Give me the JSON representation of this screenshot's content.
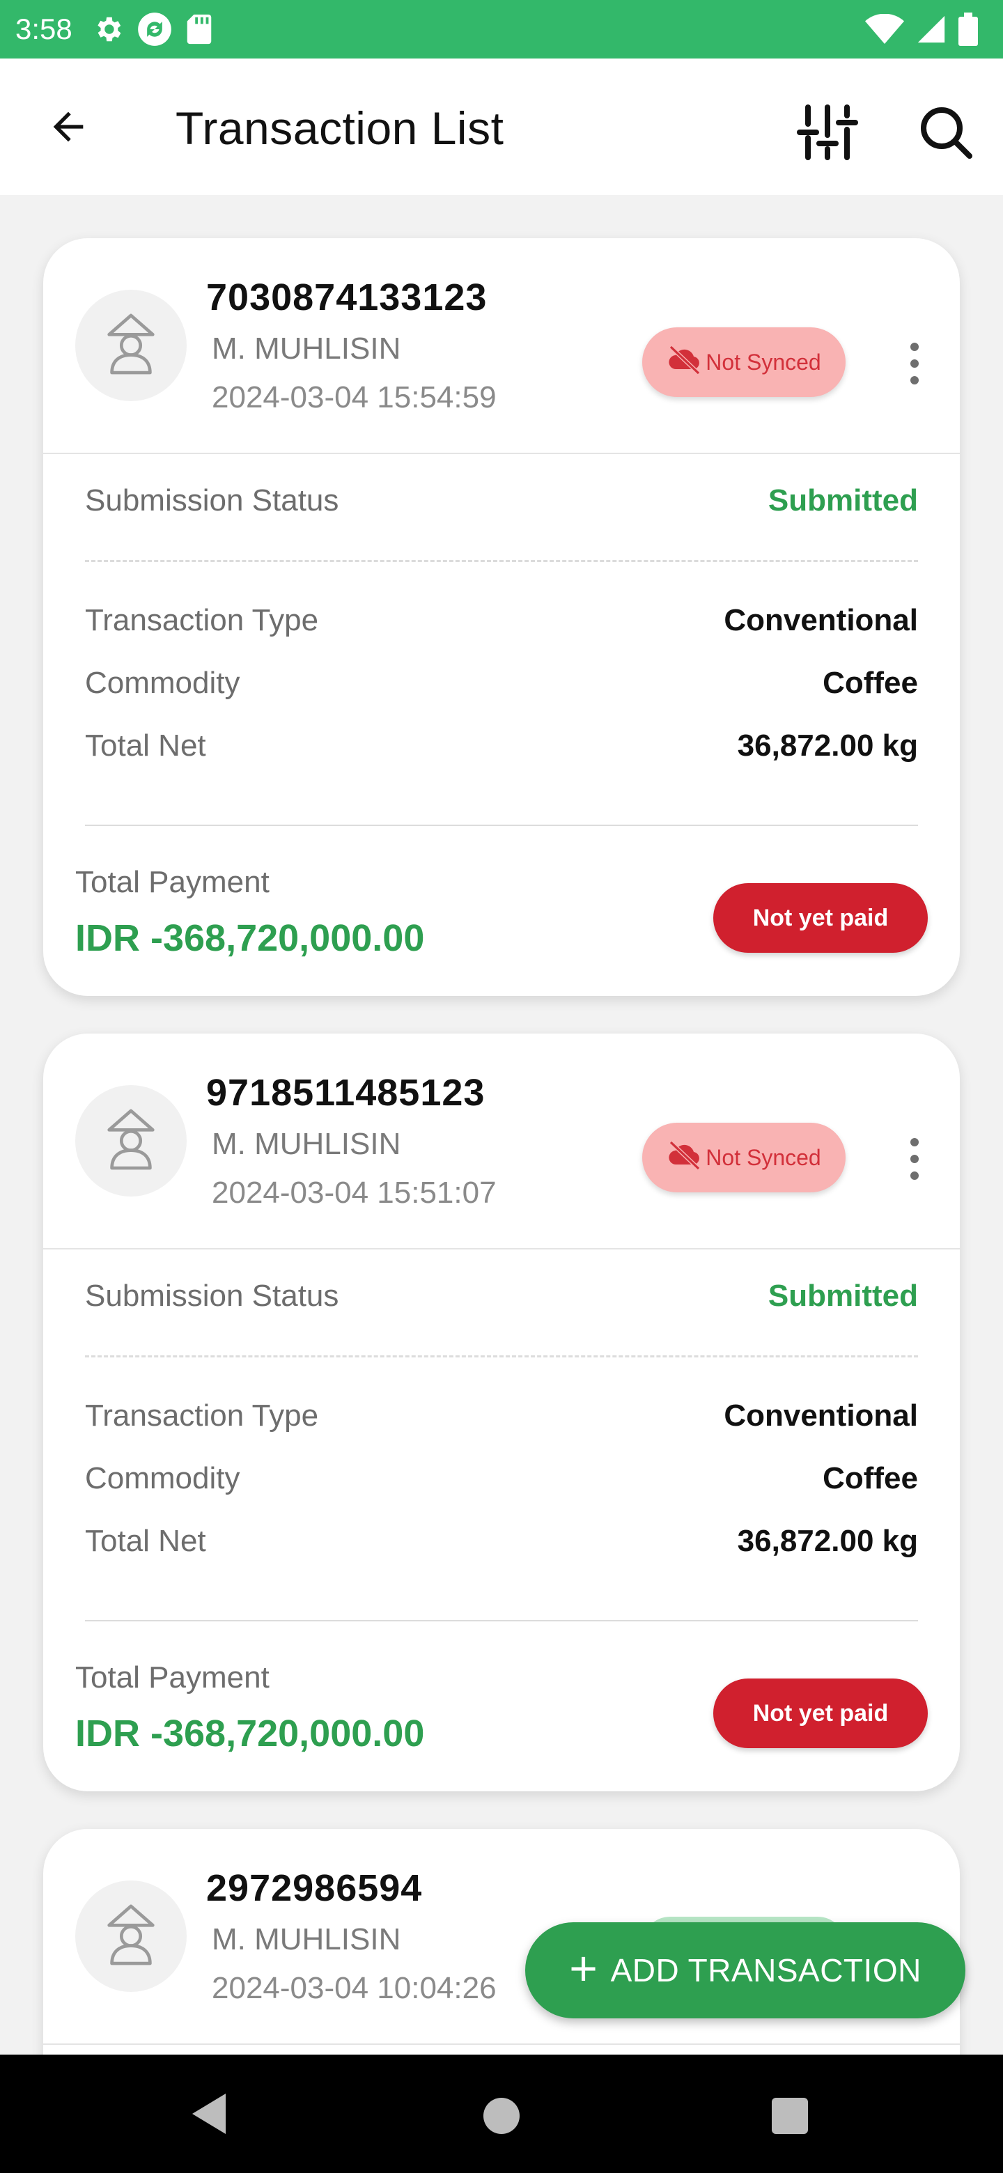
{
  "status_bar": {
    "time": "3:58",
    "icons_left": [
      "gear-icon",
      "sync-icon",
      "sd-card-icon"
    ],
    "icons_right": [
      "wifi-icon",
      "signal-icon",
      "battery-icon"
    ]
  },
  "app_bar": {
    "title": "Transaction List",
    "back_icon": "arrow-left-icon",
    "filter_icon": "sliders-icon",
    "search_icon": "search-icon"
  },
  "labels": {
    "submission_status": "Submission Status",
    "transaction_type": "Transaction Type",
    "commodity": "Commodity",
    "total_net": "Total Net",
    "total_payment": "Total Payment"
  },
  "transactions": [
    {
      "id": "7030874133123",
      "farmer": "M. MUHLISIN",
      "date": "2024-03-04 15:54:59",
      "sync_status": "Not Synced",
      "submission_status": "Submitted",
      "transaction_type": "Conventional",
      "commodity": "Coffee",
      "total_net": "36,872.00 kg",
      "total_payment": "IDR -368,720,000.00",
      "payment_status": "Not yet paid"
    },
    {
      "id": "9718511485123",
      "farmer": "M. MUHLISIN",
      "date": "2024-03-04 15:51:07",
      "sync_status": "Not Synced",
      "submission_status": "Submitted",
      "transaction_type": "Conventional",
      "commodity": "Coffee",
      "total_net": "36,872.00 kg",
      "total_payment": "IDR -368,720,000.00",
      "payment_status": "Not yet paid"
    },
    {
      "id": "2972986594",
      "farmer": "M. MUHLISIN",
      "date": "2024-03-04 10:04:26"
    }
  ],
  "fab": {
    "label": "ADD TRANSACTION",
    "plus": "+"
  },
  "colors": {
    "status_bar": "#33b86a",
    "accent_green": "#2e9f50",
    "not_paid_red": "#d0202e",
    "not_synced_bg": "#f9b3b3",
    "not_synced_text": "#d2303a"
  }
}
